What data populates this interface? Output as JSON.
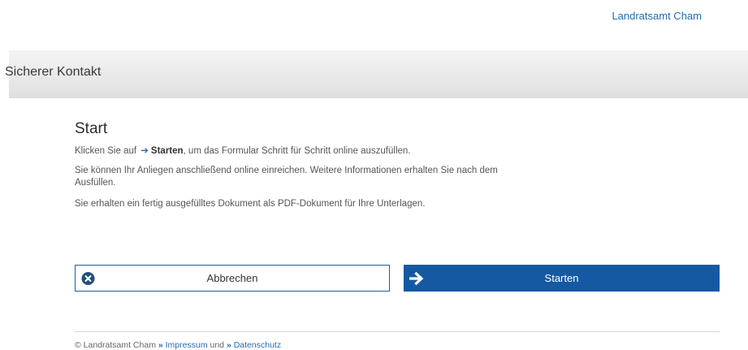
{
  "header": {
    "org_link": "Landratsamt Cham"
  },
  "banner": {
    "title": "Sicherer Kontakt"
  },
  "main": {
    "title": "Start",
    "intro_before": "Klicken Sie auf",
    "intro_link": "Starten",
    "intro_after": ", um das Formular Schritt für Schritt online auszufüllen.",
    "para2": "Sie können Ihr Anliegen anschließend online einreichen. Weitere Informationen erhalten Sie nach dem Ausfüllen.",
    "para3": "Sie erhalten ein fertig ausgefülltes Dokument als PDF-Dokument für Ihre Unterlagen."
  },
  "buttons": {
    "cancel_label": "Abbrechen",
    "start_label": "Starten"
  },
  "footer": {
    "copyright": "© Landratsamt Cham",
    "impressum": "Impressum",
    "und": "und",
    "datenschutz": "Datenschutz"
  },
  "colors": {
    "accent": "#1559a3",
    "link": "#1f6db0"
  },
  "icons": {
    "inline": "arrow-right-icon",
    "cancel": "close-circle-icon",
    "start": "arrow-right-icon",
    "footer": "double-chevron-right-icon"
  }
}
